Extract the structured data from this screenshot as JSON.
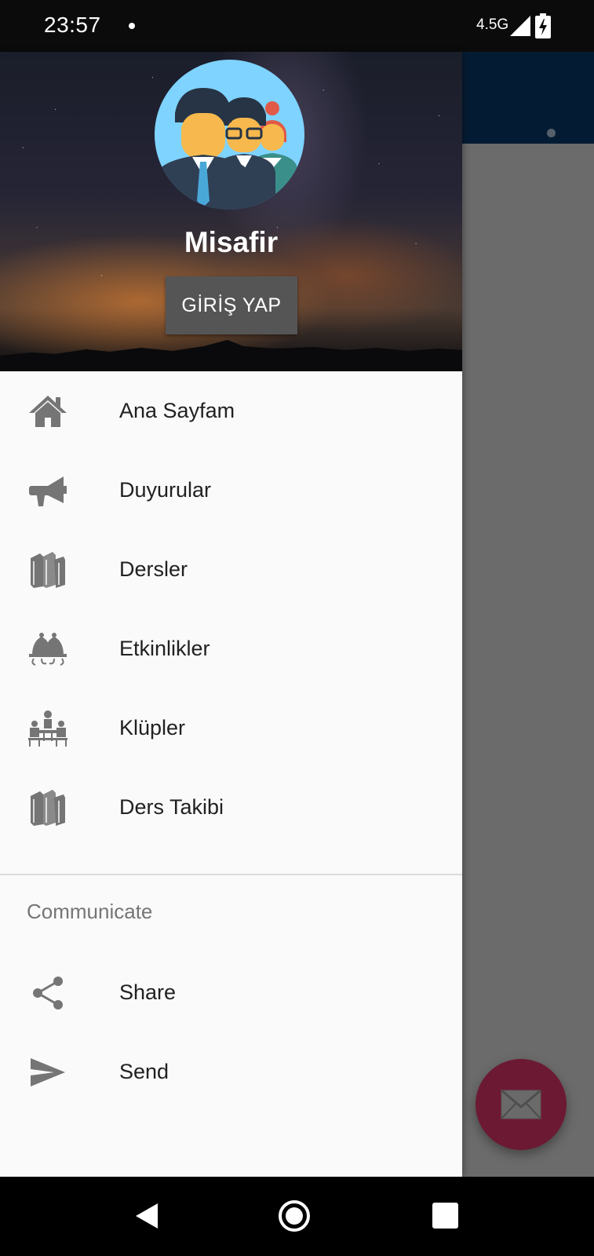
{
  "status_bar": {
    "time": "23:57",
    "network": "4.5G"
  },
  "drawer": {
    "user_name": "Misafir",
    "login_label": "GİRİŞ YAP",
    "menu_items": [
      {
        "label": "Ana Sayfam",
        "icon": "home-icon"
      },
      {
        "label": "Duyurular",
        "icon": "megaphone-icon"
      },
      {
        "label": "Dersler",
        "icon": "books-icon"
      },
      {
        "label": "Etkinlikler",
        "icon": "bells-icon"
      },
      {
        "label": "Klüpler",
        "icon": "meeting-icon"
      },
      {
        "label": "Ders Takibi",
        "icon": "books-icon"
      }
    ],
    "section_title": "Communicate",
    "sub_items": [
      {
        "label": "Share",
        "icon": "share-icon"
      },
      {
        "label": "Send",
        "icon": "send-icon"
      }
    ]
  },
  "colors": {
    "app_bar": "#041c33",
    "fab": "#6c1a33",
    "scrim": "#6b6b6b",
    "icon": "#757575"
  }
}
